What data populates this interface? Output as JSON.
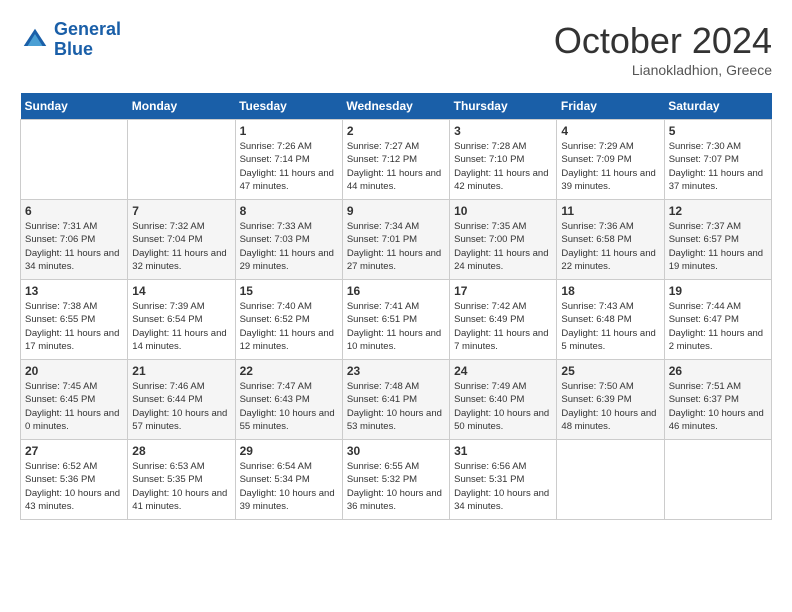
{
  "header": {
    "logo_line1": "General",
    "logo_line2": "Blue",
    "month": "October 2024",
    "location": "Lianokladhion, Greece"
  },
  "weekdays": [
    "Sunday",
    "Monday",
    "Tuesday",
    "Wednesday",
    "Thursday",
    "Friday",
    "Saturday"
  ],
  "weeks": [
    [
      {
        "day": "",
        "sunrise": "",
        "sunset": "",
        "daylight": ""
      },
      {
        "day": "",
        "sunrise": "",
        "sunset": "",
        "daylight": ""
      },
      {
        "day": "1",
        "sunrise": "Sunrise: 7:26 AM",
        "sunset": "Sunset: 7:14 PM",
        "daylight": "Daylight: 11 hours and 47 minutes."
      },
      {
        "day": "2",
        "sunrise": "Sunrise: 7:27 AM",
        "sunset": "Sunset: 7:12 PM",
        "daylight": "Daylight: 11 hours and 44 minutes."
      },
      {
        "day": "3",
        "sunrise": "Sunrise: 7:28 AM",
        "sunset": "Sunset: 7:10 PM",
        "daylight": "Daylight: 11 hours and 42 minutes."
      },
      {
        "day": "4",
        "sunrise": "Sunrise: 7:29 AM",
        "sunset": "Sunset: 7:09 PM",
        "daylight": "Daylight: 11 hours and 39 minutes."
      },
      {
        "day": "5",
        "sunrise": "Sunrise: 7:30 AM",
        "sunset": "Sunset: 7:07 PM",
        "daylight": "Daylight: 11 hours and 37 minutes."
      }
    ],
    [
      {
        "day": "6",
        "sunrise": "Sunrise: 7:31 AM",
        "sunset": "Sunset: 7:06 PM",
        "daylight": "Daylight: 11 hours and 34 minutes."
      },
      {
        "day": "7",
        "sunrise": "Sunrise: 7:32 AM",
        "sunset": "Sunset: 7:04 PM",
        "daylight": "Daylight: 11 hours and 32 minutes."
      },
      {
        "day": "8",
        "sunrise": "Sunrise: 7:33 AM",
        "sunset": "Sunset: 7:03 PM",
        "daylight": "Daylight: 11 hours and 29 minutes."
      },
      {
        "day": "9",
        "sunrise": "Sunrise: 7:34 AM",
        "sunset": "Sunset: 7:01 PM",
        "daylight": "Daylight: 11 hours and 27 minutes."
      },
      {
        "day": "10",
        "sunrise": "Sunrise: 7:35 AM",
        "sunset": "Sunset: 7:00 PM",
        "daylight": "Daylight: 11 hours and 24 minutes."
      },
      {
        "day": "11",
        "sunrise": "Sunrise: 7:36 AM",
        "sunset": "Sunset: 6:58 PM",
        "daylight": "Daylight: 11 hours and 22 minutes."
      },
      {
        "day": "12",
        "sunrise": "Sunrise: 7:37 AM",
        "sunset": "Sunset: 6:57 PM",
        "daylight": "Daylight: 11 hours and 19 minutes."
      }
    ],
    [
      {
        "day": "13",
        "sunrise": "Sunrise: 7:38 AM",
        "sunset": "Sunset: 6:55 PM",
        "daylight": "Daylight: 11 hours and 17 minutes."
      },
      {
        "day": "14",
        "sunrise": "Sunrise: 7:39 AM",
        "sunset": "Sunset: 6:54 PM",
        "daylight": "Daylight: 11 hours and 14 minutes."
      },
      {
        "day": "15",
        "sunrise": "Sunrise: 7:40 AM",
        "sunset": "Sunset: 6:52 PM",
        "daylight": "Daylight: 11 hours and 12 minutes."
      },
      {
        "day": "16",
        "sunrise": "Sunrise: 7:41 AM",
        "sunset": "Sunset: 6:51 PM",
        "daylight": "Daylight: 11 hours and 10 minutes."
      },
      {
        "day": "17",
        "sunrise": "Sunrise: 7:42 AM",
        "sunset": "Sunset: 6:49 PM",
        "daylight": "Daylight: 11 hours and 7 minutes."
      },
      {
        "day": "18",
        "sunrise": "Sunrise: 7:43 AM",
        "sunset": "Sunset: 6:48 PM",
        "daylight": "Daylight: 11 hours and 5 minutes."
      },
      {
        "day": "19",
        "sunrise": "Sunrise: 7:44 AM",
        "sunset": "Sunset: 6:47 PM",
        "daylight": "Daylight: 11 hours and 2 minutes."
      }
    ],
    [
      {
        "day": "20",
        "sunrise": "Sunrise: 7:45 AM",
        "sunset": "Sunset: 6:45 PM",
        "daylight": "Daylight: 11 hours and 0 minutes."
      },
      {
        "day": "21",
        "sunrise": "Sunrise: 7:46 AM",
        "sunset": "Sunset: 6:44 PM",
        "daylight": "Daylight: 10 hours and 57 minutes."
      },
      {
        "day": "22",
        "sunrise": "Sunrise: 7:47 AM",
        "sunset": "Sunset: 6:43 PM",
        "daylight": "Daylight: 10 hours and 55 minutes."
      },
      {
        "day": "23",
        "sunrise": "Sunrise: 7:48 AM",
        "sunset": "Sunset: 6:41 PM",
        "daylight": "Daylight: 10 hours and 53 minutes."
      },
      {
        "day": "24",
        "sunrise": "Sunrise: 7:49 AM",
        "sunset": "Sunset: 6:40 PM",
        "daylight": "Daylight: 10 hours and 50 minutes."
      },
      {
        "day": "25",
        "sunrise": "Sunrise: 7:50 AM",
        "sunset": "Sunset: 6:39 PM",
        "daylight": "Daylight: 10 hours and 48 minutes."
      },
      {
        "day": "26",
        "sunrise": "Sunrise: 7:51 AM",
        "sunset": "Sunset: 6:37 PM",
        "daylight": "Daylight: 10 hours and 46 minutes."
      }
    ],
    [
      {
        "day": "27",
        "sunrise": "Sunrise: 6:52 AM",
        "sunset": "Sunset: 5:36 PM",
        "daylight": "Daylight: 10 hours and 43 minutes."
      },
      {
        "day": "28",
        "sunrise": "Sunrise: 6:53 AM",
        "sunset": "Sunset: 5:35 PM",
        "daylight": "Daylight: 10 hours and 41 minutes."
      },
      {
        "day": "29",
        "sunrise": "Sunrise: 6:54 AM",
        "sunset": "Sunset: 5:34 PM",
        "daylight": "Daylight: 10 hours and 39 minutes."
      },
      {
        "day": "30",
        "sunrise": "Sunrise: 6:55 AM",
        "sunset": "Sunset: 5:32 PM",
        "daylight": "Daylight: 10 hours and 36 minutes."
      },
      {
        "day": "31",
        "sunrise": "Sunrise: 6:56 AM",
        "sunset": "Sunset: 5:31 PM",
        "daylight": "Daylight: 10 hours and 34 minutes."
      },
      {
        "day": "",
        "sunrise": "",
        "sunset": "",
        "daylight": ""
      },
      {
        "day": "",
        "sunrise": "",
        "sunset": "",
        "daylight": ""
      }
    ]
  ]
}
